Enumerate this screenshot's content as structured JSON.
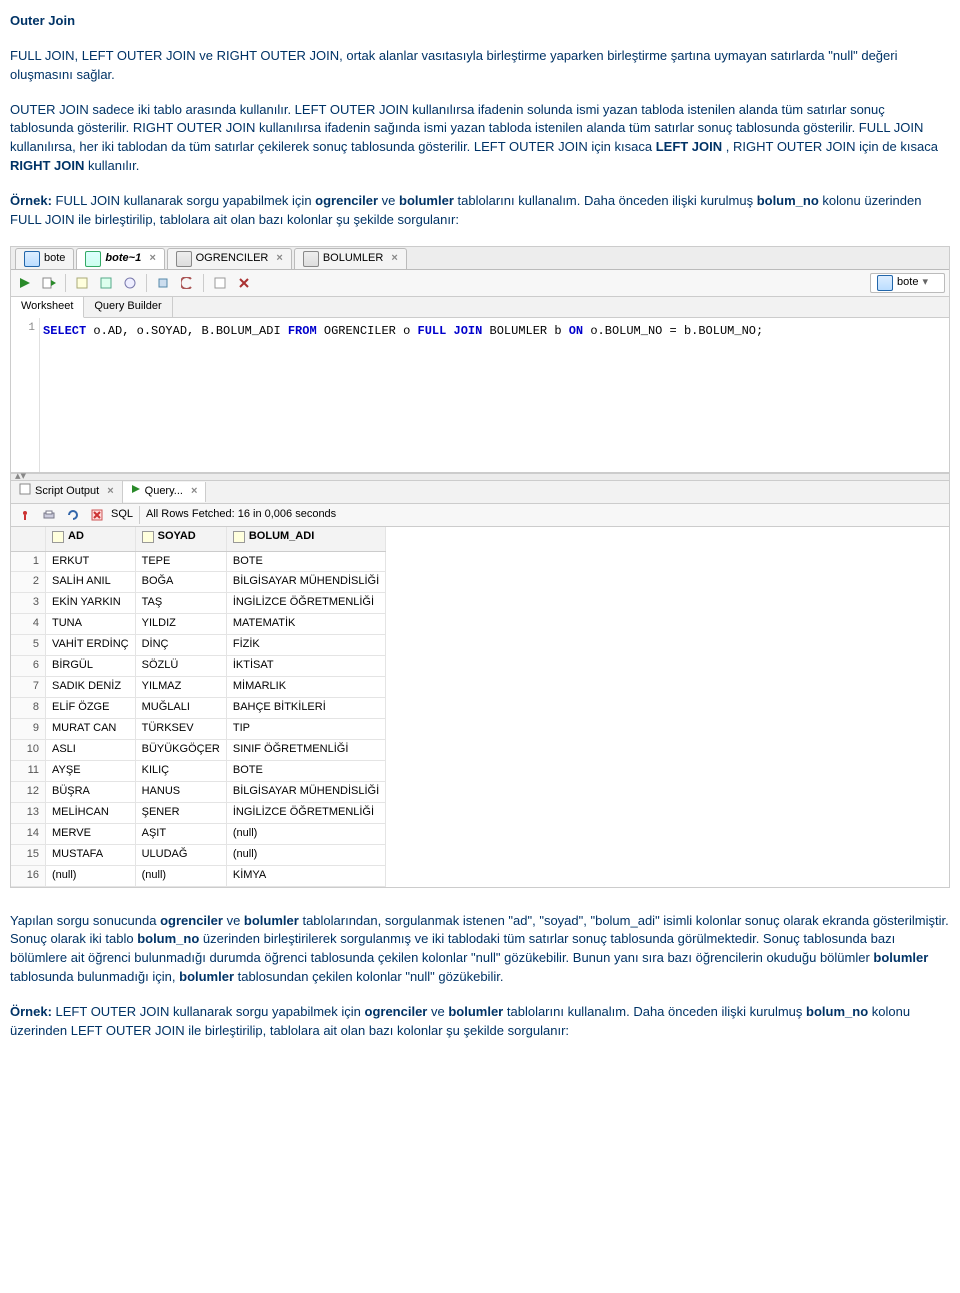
{
  "doc": {
    "title": "Outer Join",
    "para1": "FULL JOIN, LEFT OUTER JOIN ve RIGHT OUTER JOIN, ortak alanlar vasıtasıyla birleştirme yaparken birleştirme şartına uymayan satırlarda \"null\" değeri oluşmasını sağlar.",
    "para2_a": "OUTER JOIN sadece iki tablo arasında kullanılır. LEFT OUTER JOIN kullanılırsa ifadenin solunda ismi yazan tabloda istenilen alanda tüm satırlar sonuç tablosunda gösterilir. RIGHT OUTER JOIN kullanılırsa ifadenin sağında ismi yazan tabloda istenilen alanda tüm satırlar sonuç tablosunda gösterilir. FULL JOIN kullanılırsa, her iki tablodan da tüm satırlar çekilerek sonuç tablosunda gösterilir.  LEFT OUTER JOIN için kısaca ",
    "leftjoin": "LEFT JOIN",
    "para2_b": ", RIGHT OUTER JOIN için de kısaca ",
    "rightjoin": "RIGHT JOIN",
    "para2_c": " kullanılır.",
    "ornek1_label": "Örnek:",
    "ornek1_a": " FULL JOIN kullanarak sorgu yapabilmek için ",
    "ogr": "ogrenciler",
    "ornek1_b": " ve ",
    "bol": "bolumler",
    "ornek1_c": " tablolarını kullanalım. Daha önceden ilişki kurulmuş ",
    "bolno": "bolum_no",
    "ornek1_d": " kolonu üzerinden FULL JOIN ile birleştirilip, tablolara ait olan bazı kolonlar şu şekilde sorgulanır:",
    "after1_a": "Yapılan sorgu sonucunda ",
    "after1_b": " ve ",
    "after1_c": " tablolarından, sorgulanmak istenen \"ad\", \"soyad\", \"bolum_adi\" isimli kolonlar sonuç olarak ekranda gösterilmiştir. Sonuç olarak iki tablo ",
    "after1_d": " üzerinden birleştirilerek sorgulanmış ve iki tablodaki tüm satırlar sonuç tablosunda görülmektedir. Sonuç tablosunda bazı bölümlere ait öğrenci bulunmadığı durumda öğrenci tablosunda çekilen kolonlar \"null\" gözükebilir. Bunun yanı sıra bazı öğrencilerin okuduğu bölümler ",
    "after1_e": " tablosunda bulunmadığı için, ",
    "after1_f": " tablosundan çekilen kolonlar \"null\" gözükebilir.",
    "ornek2_label": "Örnek:",
    "ornek2_a": " LEFT OUTER JOIN kullanarak sorgu yapabilmek için ",
    "ornek2_b": " ve ",
    "ornek2_c": " tablolarını kullanalım. Daha önceden ilişki kurulmuş ",
    "ornek2_d": " kolonu üzerinden LEFT OUTER JOIN ile birleştirilip, tablolara ait olan bazı kolonlar şu şekilde sorgulanır:"
  },
  "sd": {
    "tabs": {
      "t1": "bote",
      "t2": "bote~1",
      "t3": "OGRENCILER",
      "t4": "BOLUMLER"
    },
    "conn": "bote",
    "subtabs": {
      "worksheet": "Worksheet",
      "qb": "Query Builder"
    },
    "line_no": "1",
    "sql": {
      "kw1": "SELECT",
      "s1": " o.AD, o.SOYAD, B.BOLUM_ADI ",
      "kw2": "FROM",
      "s2": " OGRENCILER o ",
      "kw3": "FULL JOIN",
      "s3": " BOLUMLER b ",
      "kw4": "ON",
      "s4": " o.BOLUM_NO = b.BOLUM_NO;"
    },
    "out_tabs": {
      "script": "Script Output",
      "query": "Query..."
    },
    "out_toolbar": {
      "sql": "SQL",
      "status": "All Rows Fetched: 16 in 0,006 seconds"
    },
    "cols": {
      "ad": "AD",
      "soyad": "SOYAD",
      "bolum": "BOLUM_ADI"
    }
  },
  "chart_data": {
    "type": "table",
    "columns": [
      "AD",
      "SOYAD",
      "BOLUM_ADI"
    ],
    "rows": [
      {
        "n": "1",
        "ad": "ERKUT",
        "soyad": "TEPE",
        "bolum": "BOTE"
      },
      {
        "n": "2",
        "ad": "SALİH ANIL",
        "soyad": "BOĞA",
        "bolum": "BİLGİSAYAR MÜHENDİSLİĞİ"
      },
      {
        "n": "3",
        "ad": "EKİN YARKIN",
        "soyad": "TAŞ",
        "bolum": "İNGİLİZCE ÖĞRETMENLİĞİ"
      },
      {
        "n": "4",
        "ad": "TUNA",
        "soyad": "YILDIZ",
        "bolum": "MATEMATİK"
      },
      {
        "n": "5",
        "ad": "VAHİT ERDİNÇ",
        "soyad": "DİNÇ",
        "bolum": "FİZİK"
      },
      {
        "n": "6",
        "ad": "BİRGÜL",
        "soyad": "SÖZLÜ",
        "bolum": "İKTİSAT"
      },
      {
        "n": "7",
        "ad": "SADIK DENİZ",
        "soyad": "YILMAZ",
        "bolum": "MİMARLIK"
      },
      {
        "n": "8",
        "ad": "ELİF ÖZGE",
        "soyad": "MUĞLALI",
        "bolum": "BAHÇE BİTKİLERİ"
      },
      {
        "n": "9",
        "ad": "MURAT CAN",
        "soyad": "TÜRKSEV",
        "bolum": "TIP"
      },
      {
        "n": "10",
        "ad": "ASLI",
        "soyad": "BÜYÜKGÖÇER",
        "bolum": "SINIF ÖĞRETMENLİĞİ"
      },
      {
        "n": "11",
        "ad": "AYŞE",
        "soyad": "KILIÇ",
        "bolum": "BOTE"
      },
      {
        "n": "12",
        "ad": "BÜŞRA",
        "soyad": "HANUS",
        "bolum": "BİLGİSAYAR MÜHENDİSLİĞİ"
      },
      {
        "n": "13",
        "ad": "MELİHCAN",
        "soyad": "ŞENER",
        "bolum": "İNGİLİZCE ÖĞRETMENLİĞİ"
      },
      {
        "n": "14",
        "ad": "MERVE",
        "soyad": "AŞIT",
        "bolum": "(null)"
      },
      {
        "n": "15",
        "ad": "MUSTAFA",
        "soyad": "ULUDAĞ",
        "bolum": "(null)"
      },
      {
        "n": "16",
        "ad": "(null)",
        "soyad": "(null)",
        "bolum": "KİMYA"
      }
    ]
  }
}
